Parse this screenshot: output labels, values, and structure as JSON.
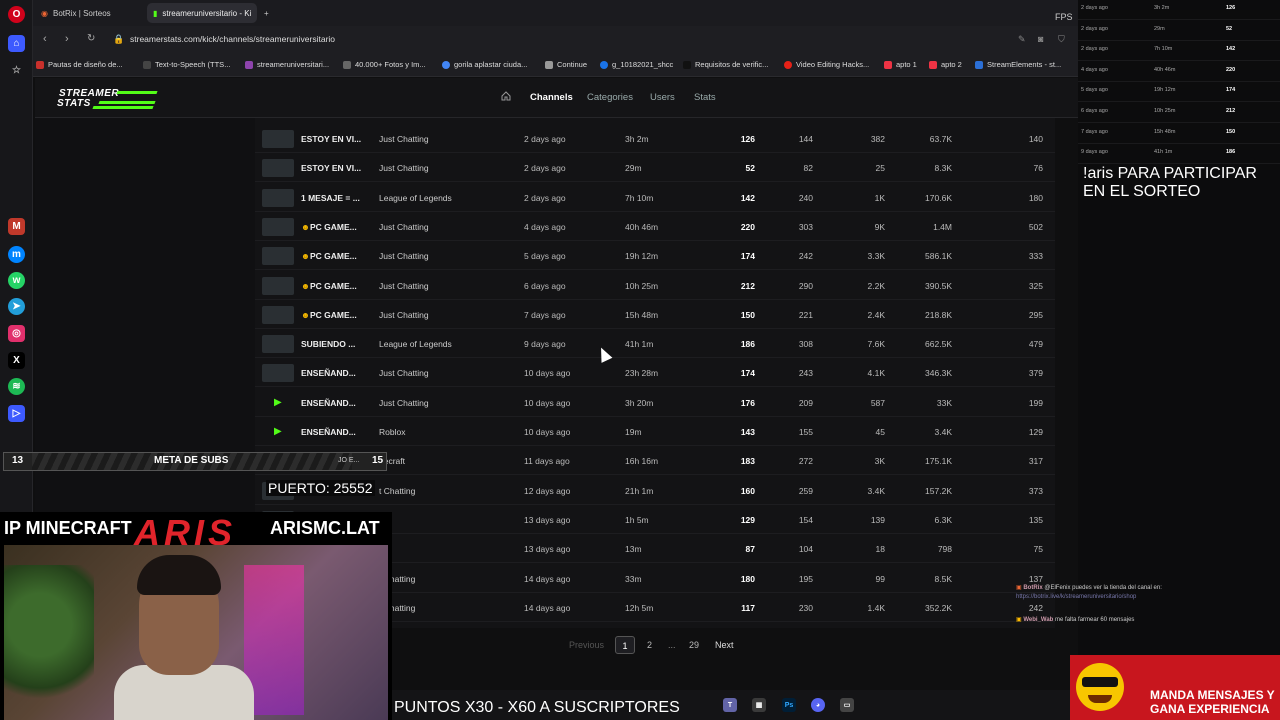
{
  "tabs": [
    {
      "label": "BotRix | Sorteos"
    },
    {
      "label": "streameruniversitario - Ki"
    }
  ],
  "fps_label": "FPS",
  "address": {
    "url": "streamerstats.com/kick/channels/streameruniversitario"
  },
  "bookmarks": [
    {
      "label": "Pautas de diseño de...",
      "color": "#c9302c"
    },
    {
      "label": "Text-to-Speech (TTS...",
      "color": "#444"
    },
    {
      "label": "streameruniversitari...",
      "color": "#8e44ad"
    },
    {
      "label": "40.000+ Fotos y Im...",
      "color": "#666"
    },
    {
      "label": "gorila aplastar ciuda...",
      "color": "#4285f4"
    },
    {
      "label": "Continue",
      "color": "#999"
    },
    {
      "label": "g_10182021_shcc",
      "color": "#1a73e8"
    },
    {
      "label": "Requisitos de verific...",
      "color": "#111"
    },
    {
      "label": "Video Editing Hacks...",
      "color": "#e62117"
    },
    {
      "label": "apto 1",
      "color": "#e34"
    },
    {
      "label": "apto 2",
      "color": "#e34"
    },
    {
      "label": "StreamElements - st...",
      "color": "#2b6fd6"
    }
  ],
  "site": {
    "logo_line1": "STREAMER",
    "logo_line2": "STATS",
    "nav": [
      "Channels",
      "Categories",
      "Users",
      "Stats"
    ],
    "accent": "#53fc18"
  },
  "streams": [
    {
      "title": "ESTOY EN VI...",
      "category": "Just Chatting",
      "ago": "2 days ago",
      "duration": "3h 2m",
      "c1": "126",
      "c2": "144",
      "c3": "382",
      "c4": "63.7K",
      "c5": "140",
      "emoji": false,
      "play": false
    },
    {
      "title": "ESTOY EN VI...",
      "category": "Just Chatting",
      "ago": "2 days ago",
      "duration": "29m",
      "c1": "52",
      "c2": "82",
      "c3": "25",
      "c4": "8.3K",
      "c5": "76",
      "emoji": false,
      "play": false
    },
    {
      "title": "1 MESAJE = ...",
      "category": "League of Legends",
      "ago": "2 days ago",
      "duration": "7h 10m",
      "c1": "142",
      "c2": "240",
      "c3": "1K",
      "c4": "170.6K",
      "c5": "180",
      "emoji": false,
      "play": false
    },
    {
      "title": "PC GAME...",
      "category": "Just Chatting",
      "ago": "4 days ago",
      "duration": "40h 46m",
      "c1": "220",
      "c2": "303",
      "c3": "9K",
      "c4": "1.4M",
      "c5": "502",
      "emoji": true,
      "play": false
    },
    {
      "title": "PC GAME...",
      "category": "Just Chatting",
      "ago": "5 days ago",
      "duration": "19h 12m",
      "c1": "174",
      "c2": "242",
      "c3": "3.3K",
      "c4": "586.1K",
      "c5": "333",
      "emoji": true,
      "play": false
    },
    {
      "title": "PC GAME...",
      "category": "Just Chatting",
      "ago": "6 days ago",
      "duration": "10h 25m",
      "c1": "212",
      "c2": "290",
      "c3": "2.2K",
      "c4": "390.5K",
      "c5": "325",
      "emoji": true,
      "play": false
    },
    {
      "title": "PC GAME...",
      "category": "Just Chatting",
      "ago": "7 days ago",
      "duration": "15h 48m",
      "c1": "150",
      "c2": "221",
      "c3": "2.4K",
      "c4": "218.8K",
      "c5": "295",
      "emoji": true,
      "play": false
    },
    {
      "title": "SUBIENDO ...",
      "category": "League of Legends",
      "ago": "9 days ago",
      "duration": "41h 1m",
      "c1": "186",
      "c2": "308",
      "c3": "7.6K",
      "c4": "662.5K",
      "c5": "479",
      "emoji": false,
      "play": false
    },
    {
      "title": "ENSEÑAND...",
      "category": "Just Chatting",
      "ago": "10 days ago",
      "duration": "23h 28m",
      "c1": "174",
      "c2": "243",
      "c3": "4.1K",
      "c4": "346.3K",
      "c5": "379",
      "emoji": false,
      "play": false
    },
    {
      "title": "ENSEÑAND...",
      "category": "Just Chatting",
      "ago": "10 days ago",
      "duration": "3h 20m",
      "c1": "176",
      "c2": "209",
      "c3": "587",
      "c4": "33K",
      "c5": "199",
      "emoji": false,
      "play": true
    },
    {
      "title": "ENSEÑAND...",
      "category": "Roblox",
      "ago": "10 days ago",
      "duration": "19m",
      "c1": "143",
      "c2": "155",
      "c3": "45",
      "c4": "3.4K",
      "c5": "129",
      "emoji": false,
      "play": true
    },
    {
      "title": "",
      "category": "necraft",
      "ago": "11 days ago",
      "duration": "16h 16m",
      "c1": "183",
      "c2": "272",
      "c3": "3K",
      "c4": "175.1K",
      "c5": "317",
      "emoji": false,
      "play": false
    },
    {
      "title": "",
      "category": "t Chatting",
      "ago": "12 days ago",
      "duration": "21h 1m",
      "c1": "160",
      "c2": "259",
      "c3": "3.4K",
      "c4": "157.2K",
      "c5": "373",
      "emoji": false,
      "play": false
    },
    {
      "title": "",
      "category": "",
      "ago": "13 days ago",
      "duration": "1h 5m",
      "c1": "129",
      "c2": "154",
      "c3": "139",
      "c4": "6.3K",
      "c5": "135",
      "emoji": false,
      "play": false
    },
    {
      "title": "",
      "category": "",
      "ago": "13 days ago",
      "duration": "13m",
      "c1": "87",
      "c2": "104",
      "c3": "18",
      "c4": "798",
      "c5": "75",
      "emoji": false,
      "play": false
    },
    {
      "title": "",
      "category": "t Chatting",
      "ago": "14 days ago",
      "duration": "33m",
      "c1": "180",
      "c2": "195",
      "c3": "99",
      "c4": "8.5K",
      "c5": "137",
      "emoji": false,
      "play": false
    },
    {
      "title": "",
      "category": "t Chatting",
      "ago": "14 days ago",
      "duration": "12h 5m",
      "c1": "117",
      "c2": "230",
      "c3": "1.4K",
      "c4": "352.2K",
      "c5": "242",
      "emoji": false,
      "play": false
    }
  ],
  "pagination": {
    "previous": "Previous",
    "current": "1",
    "next_page": "2",
    "ellipsis": "...",
    "last": "29",
    "next": "Next"
  },
  "mini_rows": [
    {
      "ago": "2 days ago",
      "dur": "3h 2m",
      "v": "126"
    },
    {
      "ago": "2 days ago",
      "dur": "29m",
      "v": "52"
    },
    {
      "ago": "2 days ago",
      "dur": "7h 10m",
      "v": "142"
    },
    {
      "ago": "4 days ago",
      "dur": "40h 46m",
      "v": "220"
    },
    {
      "ago": "5 days ago",
      "dur": "19h 12m",
      "v": "174"
    },
    {
      "ago": "6 days ago",
      "dur": "10h 25m",
      "v": "212"
    },
    {
      "ago": "7 days ago",
      "dur": "15h 48m",
      "v": "150"
    },
    {
      "ago": "9 days ago",
      "dur": "41h 1m",
      "v": "186"
    }
  ],
  "overlay": {
    "giveaway": "!aris PARA PARTICIPAR EN EL SORTEO",
    "meta_left": "13",
    "meta_label": "META DE SUBS",
    "meta_right": "15",
    "meta_tick": "JO E...",
    "puerto": "PUERTO: 25552",
    "ip_label": "IP MINECRAFT",
    "aris": "ARIS",
    "site": "ARISMC.LAT",
    "puntos": "PUNTOS X30 - X60 A SUSCRIPTORES",
    "promo_line1": "MANDA MENSAJES Y",
    "promo_line2": "GANA EXPERIENCIA"
  },
  "chat": [
    {
      "user": "BotRix",
      "text": "@ElFenix puedes ver la tienda del canal en:"
    },
    {
      "user": "",
      "text": "https://botrix.live/k/streameruniversitario/shop"
    },
    {
      "user": "Webi_Wab",
      "text": "me falta farmear 60 mensajes"
    }
  ]
}
